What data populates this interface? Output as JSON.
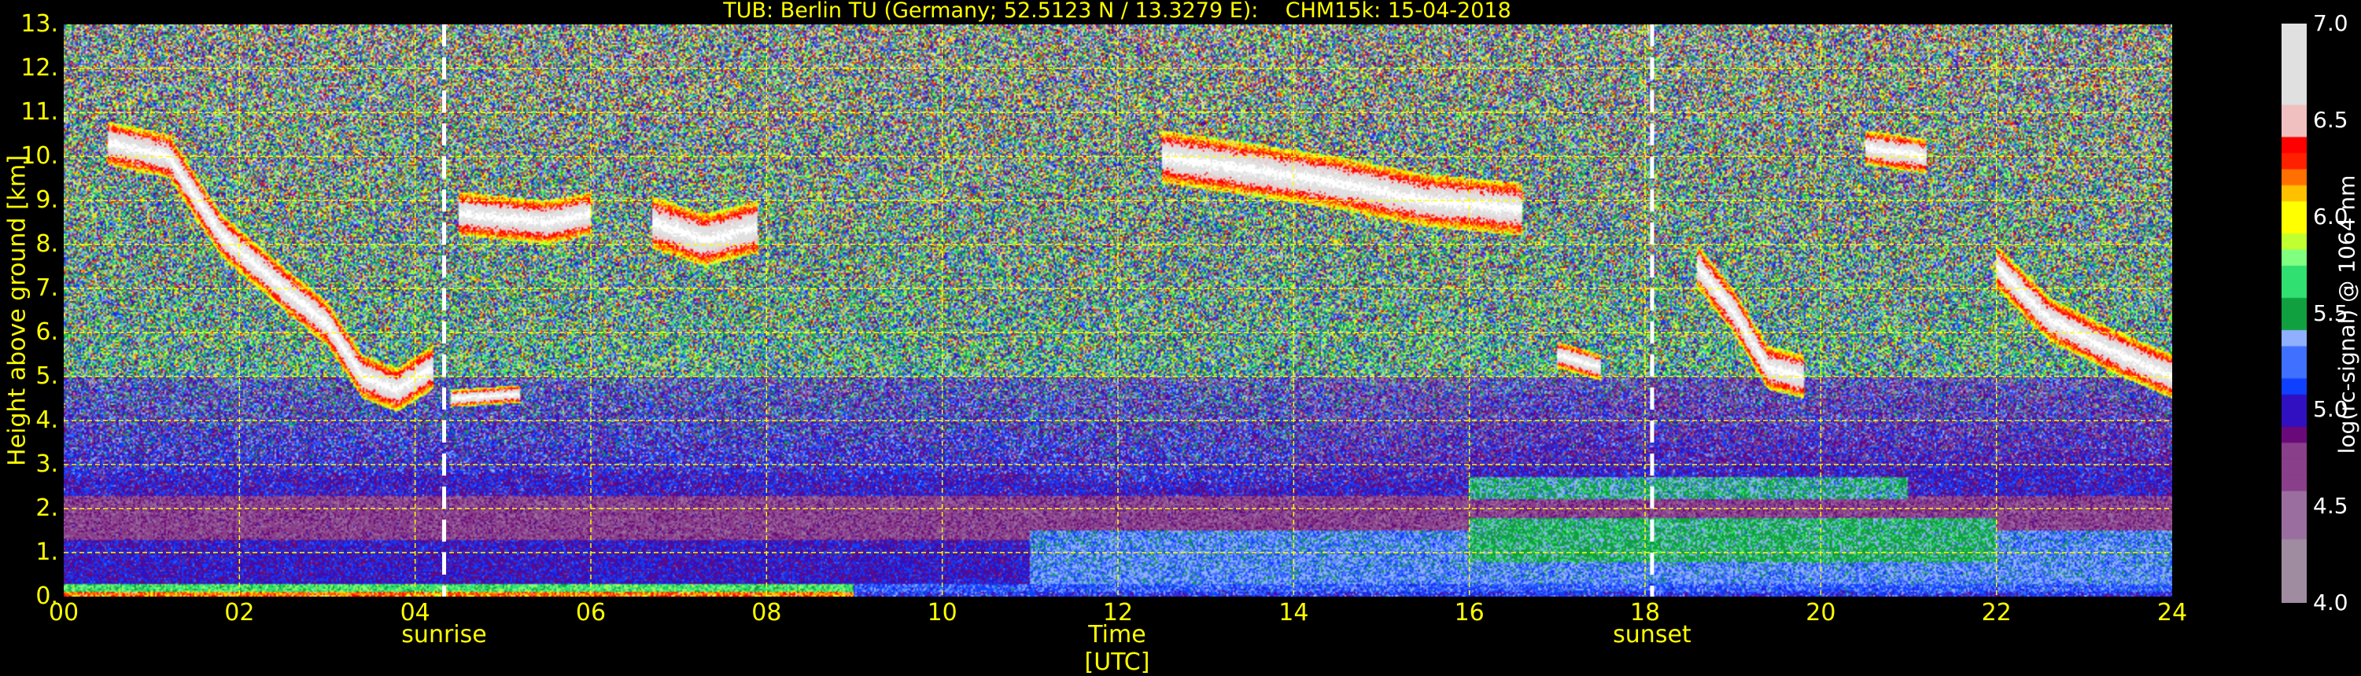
{
  "chart_data": {
    "type": "heatmap",
    "title": "TUB: Berlin TU (Germany; 52.5123 N / 13.3279 E):    CHM15k: 15-04-2018",
    "xlabel": "Time [UTC]",
    "ylabel": "Height above ground [km]",
    "xlim": [
      0,
      24
    ],
    "ylim": [
      0,
      13
    ],
    "xticks": [
      "00",
      "02",
      "04",
      "06",
      "08",
      "10",
      "12",
      "14",
      "16",
      "18",
      "20",
      "22",
      "24"
    ],
    "yticks": [
      "0.",
      "1.",
      "2.",
      "3.",
      "4.",
      "5.",
      "6.",
      "7.",
      "8.",
      "9.",
      "10.",
      "11.",
      "12.",
      "13."
    ],
    "grid": true,
    "colorbar": {
      "label": "log(rc-signal) @ 1064 nm",
      "range": [
        4.0,
        7.0
      ],
      "ticks": [
        "4.0",
        "4.5",
        "5.0",
        "5.5",
        "6.0",
        "6.5",
        "7.0"
      ]
    },
    "annotations": [
      {
        "label": "sunrise",
        "time": 4.33
      },
      {
        "label": "sunset",
        "time": 18.08
      }
    ],
    "clouds": [
      {
        "path": [
          [
            0.5,
            10.3
          ],
          [
            1.2,
            10.0
          ],
          [
            1.8,
            8.2
          ],
          [
            2.5,
            7.0
          ],
          [
            3.0,
            6.2
          ],
          [
            3.4,
            5.0
          ],
          [
            3.8,
            4.7
          ],
          [
            4.2,
            5.2
          ]
        ],
        "thickness": 0.5
      },
      {
        "path": [
          [
            4.4,
            4.5
          ],
          [
            5.2,
            4.6
          ]
        ],
        "thickness": 0.2
      },
      {
        "path": [
          [
            4.5,
            8.7
          ],
          [
            5.5,
            8.5
          ],
          [
            6.0,
            8.7
          ]
        ],
        "thickness": 0.5
      },
      {
        "path": [
          [
            6.7,
            8.5
          ],
          [
            7.3,
            8.1
          ],
          [
            7.9,
            8.4
          ]
        ],
        "thickness": 0.6
      },
      {
        "path": [
          [
            12.5,
            10.0
          ],
          [
            13.5,
            9.7
          ],
          [
            14.5,
            9.4
          ],
          [
            15.5,
            9.0
          ],
          [
            16.6,
            8.8
          ]
        ],
        "thickness": 0.6
      },
      {
        "path": [
          [
            18.6,
            7.5
          ],
          [
            19.0,
            6.5
          ],
          [
            19.4,
            5.2
          ],
          [
            19.8,
            5.0
          ]
        ],
        "thickness": 0.5
      },
      {
        "path": [
          [
            20.5,
            10.2
          ],
          [
            21.2,
            10.0
          ]
        ],
        "thickness": 0.4
      },
      {
        "path": [
          [
            22.0,
            7.5
          ],
          [
            22.6,
            6.3
          ],
          [
            23.3,
            5.6
          ],
          [
            24.0,
            5.0
          ]
        ],
        "thickness": 0.5
      },
      {
        "path": [
          [
            17.0,
            5.5
          ],
          [
            17.5,
            5.2
          ]
        ],
        "thickness": 0.3
      }
    ],
    "colors": {
      "background": "#000000",
      "text": "#ffff00",
      "grid": "#ffff00",
      "marker": "#ffffff"
    }
  }
}
